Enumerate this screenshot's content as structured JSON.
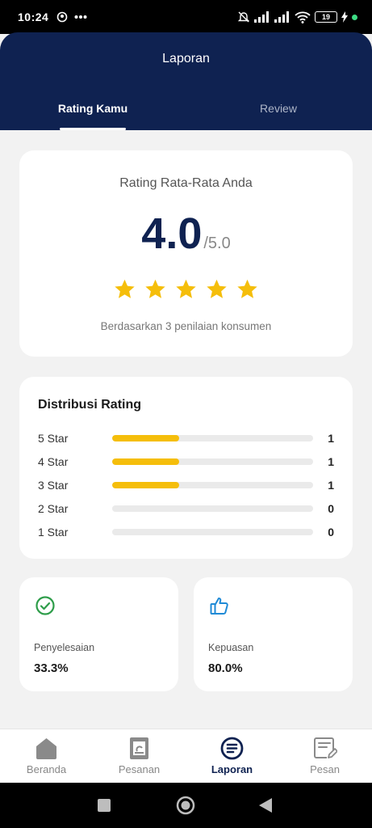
{
  "status_bar": {
    "time": "10:24",
    "battery": "19"
  },
  "header": {
    "title": "Laporan",
    "tabs": [
      {
        "label": "Rating Kamu",
        "active": true
      },
      {
        "label": "Review",
        "active": false
      }
    ]
  },
  "average_card": {
    "title": "Rating Rata-Rata Anda",
    "score": "4.0",
    "max": "/5.0",
    "stars_filled": 5,
    "basis": "Berdasarkan 3 penilaian konsumen"
  },
  "distribution": {
    "title": "Distribusi Rating",
    "rows": [
      {
        "label": "5 Star",
        "count": "1",
        "fraction": 0.333
      },
      {
        "label": "4 Star",
        "count": "1",
        "fraction": 0.333
      },
      {
        "label": "3 Star",
        "count": "1",
        "fraction": 0.333
      },
      {
        "label": "2 Star",
        "count": "0",
        "fraction": 0
      },
      {
        "label": "1 Star",
        "count": "0",
        "fraction": 0
      }
    ]
  },
  "stats": {
    "completion": {
      "label": "Penyelesaian",
      "value": "33.3%",
      "icon": "check-circle-icon",
      "color": "#2e9d4a"
    },
    "satisfaction": {
      "label": "Kepuasan",
      "value": "80.0%",
      "icon": "thumbs-up-icon",
      "color": "#1f8ad6"
    }
  },
  "bottom_nav": {
    "items": [
      {
        "label": "Beranda",
        "icon": "home-icon",
        "active": false
      },
      {
        "label": "Pesanan",
        "icon": "order-icon",
        "active": false
      },
      {
        "label": "Laporan",
        "icon": "report-icon",
        "active": true
      },
      {
        "label": "Pesan",
        "icon": "message-icon",
        "active": false
      }
    ]
  },
  "colors": {
    "primary": "#0f2251",
    "star": "#f5be0b",
    "background": "#f2f2f2"
  }
}
